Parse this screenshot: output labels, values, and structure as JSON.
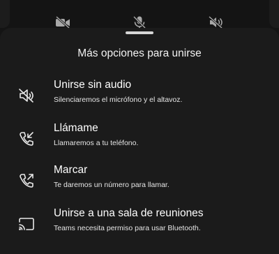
{
  "top_controls": [
    {
      "icon": "video-off-icon"
    },
    {
      "icon": "mic-off-icon"
    },
    {
      "icon": "speaker-off-icon"
    }
  ],
  "sheet": {
    "title": "Más opciones para unirse",
    "options": [
      {
        "icon": "speaker-off-icon",
        "title": "Unirse sin audio",
        "subtitle": "Silenciaremos el micrófono y el altavoz."
      },
      {
        "icon": "incoming-call-icon",
        "title": "Llámame",
        "subtitle": "Llamaremos a tu teléfono."
      },
      {
        "icon": "outgoing-call-icon",
        "title": "Marcar",
        "subtitle": "Te daremos un número para llamar."
      },
      {
        "icon": "cast-room-icon",
        "title": "Unirse a una sala de reuniones",
        "subtitle": "Teams necesita permiso para usar Bluetooth."
      }
    ]
  },
  "colors": {
    "background": "#0d0d0d",
    "sheet": "#1b1b1b",
    "text": "#ffffff"
  }
}
